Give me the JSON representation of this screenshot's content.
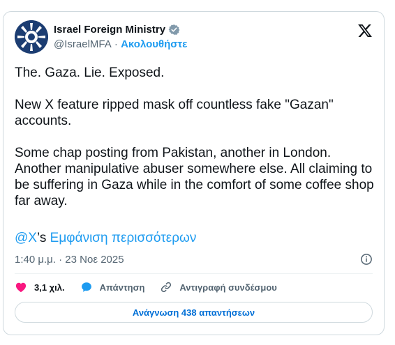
{
  "author": {
    "name": "Israel Foreign Ministry",
    "handle": "@IsraelMFA",
    "separator": " · ",
    "follow_label": "Ακολουθήστε",
    "verified_badge": "gray-check-badge-icon"
  },
  "tweet": {
    "paragraphs": [
      "The. Gaza. Lie. Exposed.",
      "New X feature ripped mask off countless fake \"Gazan\" accounts.",
      "Some chap posting from Pakistan, another in London. Another manipulative abuser somewhere else. All claiming to be suffering in Gaza while in the comfort of some coffee shop far away."
    ],
    "mention": "@X",
    "possessive": "’s",
    "show_more": "Εμφάνιση περισσότερων",
    "timestamp": "1:40 μ.μ. · 23 Νοε 2025"
  },
  "actions": {
    "likes": "3,1 χιλ.",
    "reply_label": "Απάντηση",
    "copy_link_label": "Αντιγραφή συνδέσμου"
  },
  "read_replies_label": "Ανάγνωση 438 απαντήσεων",
  "colors": {
    "accent": "#1d9bf0",
    "like": "#f91880",
    "muted": "#536471",
    "border": "#cfd9de"
  },
  "icons": [
    "x-logo-icon",
    "info-icon",
    "heart-icon",
    "speech-bubble-icon",
    "link-icon"
  ]
}
